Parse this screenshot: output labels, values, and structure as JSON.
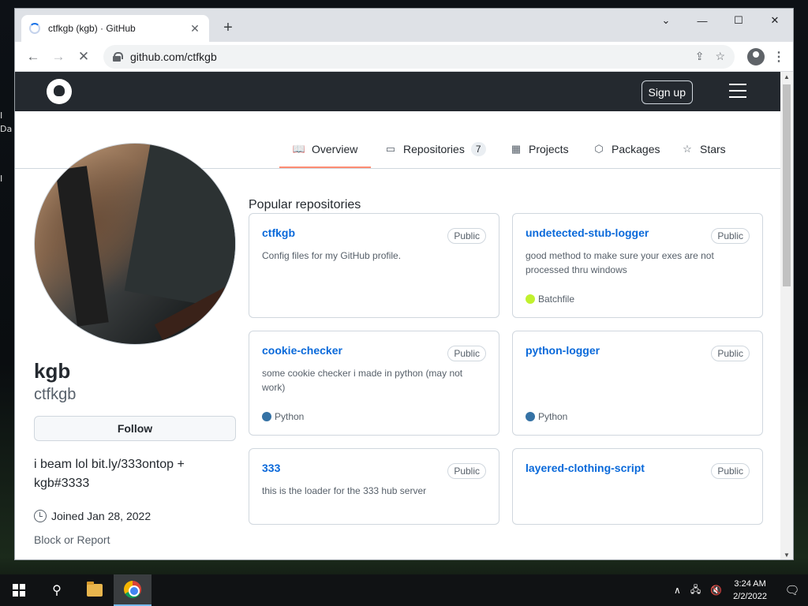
{
  "desktop": {
    "left_labels": [
      "I",
      "Da",
      "I"
    ]
  },
  "browser": {
    "tab_title": "ctfkgb (kgb) · GitHub",
    "new_tab": "+",
    "url": "github.com/ctfkgb"
  },
  "github": {
    "signup_label": "Sign up",
    "nav": {
      "overview": "Overview",
      "repositories": "Repositories",
      "repositories_count": "7",
      "projects": "Projects",
      "packages": "Packages",
      "stars": "Stars"
    },
    "profile": {
      "name": "kgb",
      "login": "ctfkgb",
      "follow_label": "Follow",
      "bio": "i beam lol bit.ly/333ontop + kgb#3333",
      "joined": "Joined Jan 28, 2022",
      "block_report": "Block or Report"
    },
    "popular_title": "Popular repositories",
    "repos": [
      {
        "name": "ctfkgb",
        "visibility": "Public",
        "description": "Config files for my GitHub profile.",
        "language": ""
      },
      {
        "name": "undetected-stub-logger",
        "visibility": "Public",
        "description": "good method to make sure your exes are not processed thru windows",
        "language": "Batchfile"
      },
      {
        "name": "cookie-checker",
        "visibility": "Public",
        "description": "some cookie checker i made in python (may not work)",
        "language": "Python"
      },
      {
        "name": "python-logger",
        "visibility": "Public",
        "description": "",
        "language": "Python"
      },
      {
        "name": "333",
        "visibility": "Public",
        "description": "this is the loader for the 333 hub server",
        "language": ""
      },
      {
        "name": "layered-clothing-script",
        "visibility": "Public",
        "description": "",
        "language": ""
      }
    ],
    "lang_colors": {
      "Python": "#3572a5",
      "Batchfile": "#c1f12e"
    }
  },
  "taskbar": {
    "time": "3:24 AM",
    "date": "2/2/2022"
  }
}
